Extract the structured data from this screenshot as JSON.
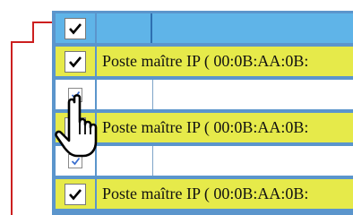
{
  "table": {
    "rows": [
      {
        "type": "header",
        "checked": true
      },
      {
        "type": "host",
        "checked": true,
        "label": "Poste maître IP ( 00:0B:AA:0B:"
      },
      {
        "type": "channel",
        "checked": true
      },
      {
        "type": "host",
        "checked": true,
        "label": "Poste maître IP ( 00:0B:AA:0B:"
      },
      {
        "type": "channel",
        "checked": true
      },
      {
        "type": "host",
        "checked": true,
        "label": "Poste maître IP ( 00:0B:AA:0B:"
      }
    ]
  },
  "colors": {
    "header": "#5fb4e8",
    "host_row": "#e6ea4a",
    "panel": "#5b95cc",
    "bracket": "#cc1f1f",
    "small_check": "#3b6fcf"
  },
  "cursor": {
    "icon": "hand-pointer-icon"
  }
}
